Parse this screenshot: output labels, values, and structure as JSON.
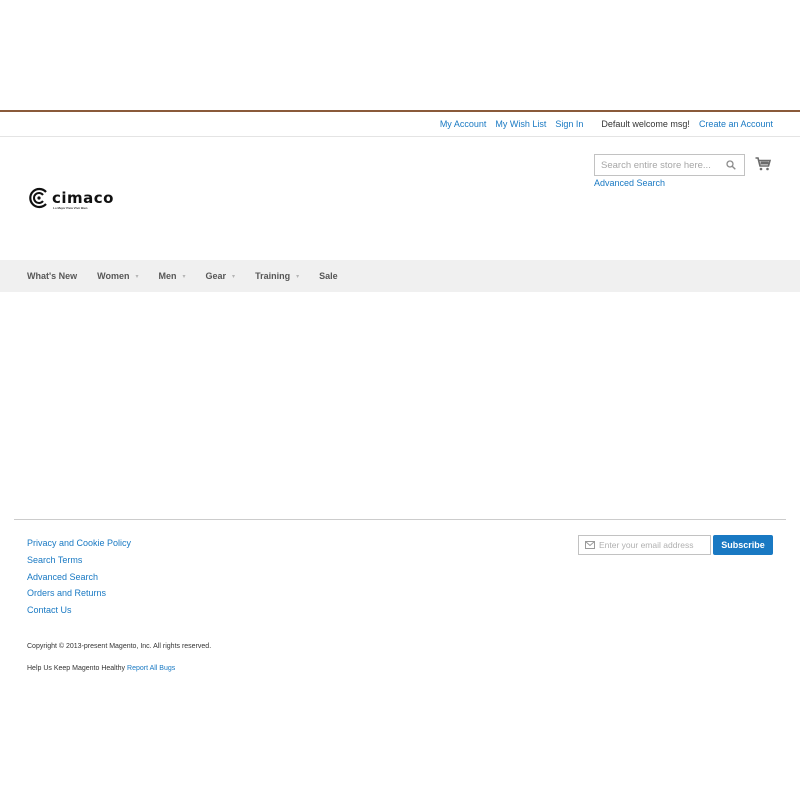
{
  "header": {
    "links": {
      "my_account": "My Account",
      "wish_list": "My Wish List",
      "sign_in": "Sign In",
      "welcome": "Default welcome msg!",
      "create_account": "Create an Account"
    }
  },
  "logo": {
    "text": "cimaco",
    "tagline": "Lo Mejor Para Vivir Bien"
  },
  "search": {
    "placeholder": "Search entire store here...",
    "advanced_link": "Advanced Search",
    "icon": "search-icon"
  },
  "cart": {
    "icon": "cart-icon"
  },
  "nav": {
    "items": [
      {
        "label": "What's New",
        "has_submenu": false
      },
      {
        "label": "Women",
        "has_submenu": true
      },
      {
        "label": "Men",
        "has_submenu": true
      },
      {
        "label": "Gear",
        "has_submenu": true
      },
      {
        "label": "Training",
        "has_submenu": true
      },
      {
        "label": "Sale",
        "has_submenu": false
      }
    ]
  },
  "footer": {
    "links": [
      "Privacy and Cookie Policy",
      "Search Terms",
      "Advanced Search",
      "Orders and Returns",
      "Contact Us"
    ],
    "newsletter": {
      "placeholder": "Enter your email address",
      "button": "Subscribe",
      "icon": "mail-icon"
    },
    "copyright": "Copyright © 2013-present Magento, Inc. All rights reserved.",
    "bugs_text": "Help Us Keep Magento Healthy",
    "bugs_link": "Report All Bugs"
  },
  "colors": {
    "link": "#1979c3",
    "nav_bg": "#f0f0f0",
    "top_rule": "#8a5a3a",
    "button": "#1979c3"
  }
}
